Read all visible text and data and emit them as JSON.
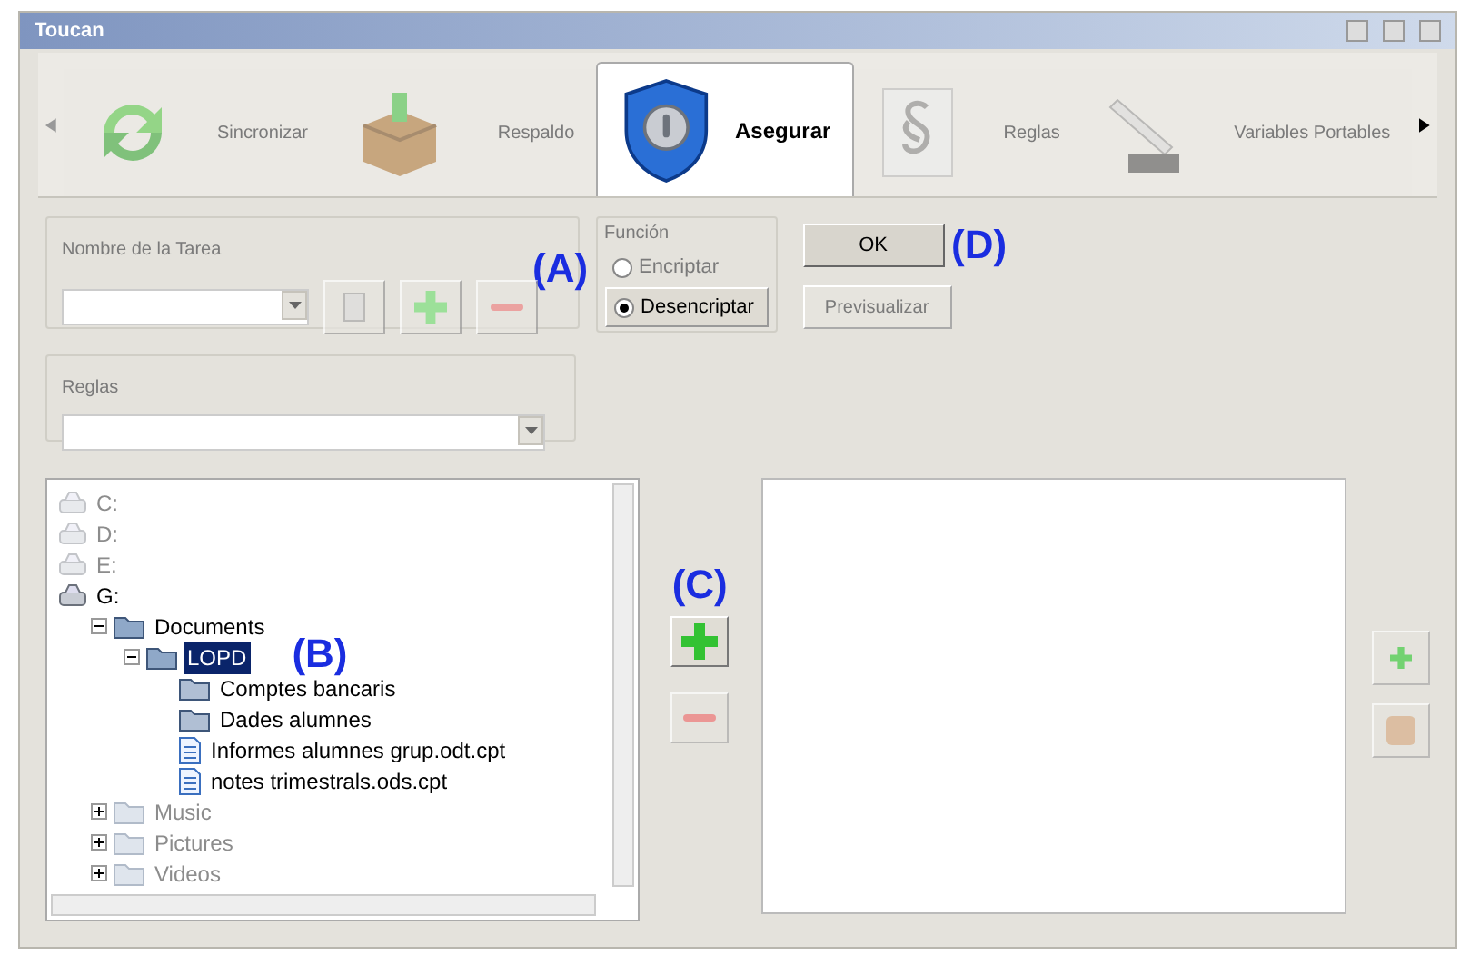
{
  "window": {
    "title": "Toucan"
  },
  "tabs": [
    {
      "label": "Sincronizar",
      "selected": false
    },
    {
      "label": "Respaldo",
      "selected": false
    },
    {
      "label": "Asegurar",
      "selected": true
    },
    {
      "label": "Reglas",
      "selected": false
    },
    {
      "label": "Variables Portables",
      "selected": false
    }
  ],
  "task_group": {
    "label": "Nombre de la Tarea"
  },
  "function_group": {
    "label": "Función",
    "options": [
      {
        "label": "Encriptar",
        "selected": false
      },
      {
        "label": "Desencriptar",
        "selected": true
      }
    ]
  },
  "buttons": {
    "ok": "OK",
    "preview": "Previsualizar"
  },
  "rules_group": {
    "label": "Reglas"
  },
  "tree": [
    {
      "label": "C:",
      "kind": "drive",
      "dimmed": true
    },
    {
      "label": "D:",
      "kind": "drive",
      "dimmed": true
    },
    {
      "label": "E:",
      "kind": "drive",
      "dimmed": true
    },
    {
      "label": "G:",
      "kind": "drive",
      "dimmed": false,
      "children": [
        {
          "label": "Documents",
          "kind": "folder",
          "dimmed": false,
          "expanded": true,
          "selected": false,
          "children": [
            {
              "label": "LOPD",
              "kind": "folder",
              "dimmed": false,
              "expanded": true,
              "selected": true,
              "children": [
                {
                  "label": "Comptes bancaris",
                  "kind": "folder",
                  "dimmed": false,
                  "selected": false
                },
                {
                  "label": "Dades alumnes",
                  "kind": "folder",
                  "dimmed": false,
                  "selected": false
                },
                {
                  "label": "Informes alumnes grup.odt.cpt",
                  "kind": "file",
                  "dimmed": false,
                  "selected": false
                },
                {
                  "label": "notes trimestrals.ods.cpt",
                  "kind": "file",
                  "dimmed": false,
                  "selected": false
                }
              ]
            }
          ]
        },
        {
          "label": "Music",
          "kind": "folder",
          "dimmed": true,
          "expanded": false,
          "selected": false
        },
        {
          "label": "Pictures",
          "kind": "folder",
          "dimmed": true,
          "expanded": false,
          "selected": false
        },
        {
          "label": "Videos",
          "kind": "folder",
          "dimmed": true,
          "expanded": false,
          "selected": false
        }
      ]
    }
  ],
  "annotations": [
    "(A)",
    "(B)",
    "(C)",
    "(D)"
  ]
}
